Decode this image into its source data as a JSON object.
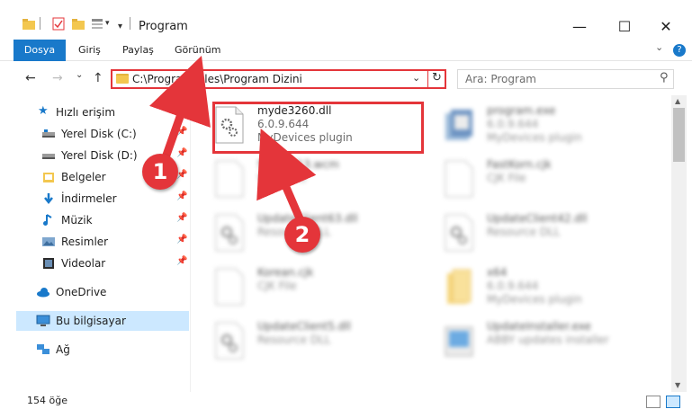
{
  "window": {
    "title": "Program",
    "controls": {
      "minimize": "—",
      "maximize": "☐",
      "close": "✕"
    }
  },
  "ribbon": {
    "tabs": [
      "Dosya",
      "Giriş",
      "Paylaş",
      "Görünüm"
    ],
    "expand_chevron": "⌄",
    "help": "?"
  },
  "navigation": {
    "back": "←",
    "forward": "→",
    "recent": "⌄",
    "up": "↑",
    "address_path": "C:\\Program Files\\Program Dizini",
    "address_dropdown": "⌄",
    "refresh": "↻",
    "search_placeholder": "Ara: Program",
    "search_glyph": "⚲"
  },
  "sidebar": {
    "quick_access": "Hızlı erişim",
    "items": [
      {
        "label": "Yerel Disk (C:)",
        "icon": "drive-icon",
        "pinned": true
      },
      {
        "label": "Yerel Disk (D:)",
        "icon": "drive-icon",
        "pinned": true
      },
      {
        "label": "Belgeler",
        "icon": "documents-icon",
        "pinned": true
      },
      {
        "label": "İndirmeler",
        "icon": "downloads-icon",
        "pinned": true
      },
      {
        "label": "Müzik",
        "icon": "music-icon",
        "pinned": true
      },
      {
        "label": "Resimler",
        "icon": "pictures-icon",
        "pinned": true
      },
      {
        "label": "Videolar",
        "icon": "videos-icon",
        "pinned": true
      }
    ],
    "onedrive": "OneDrive",
    "this_pc": "Bu bilgisayar",
    "network": "Ağ"
  },
  "files": [
    {
      "name": "myde3260.dll",
      "line2": "6.0.9.644",
      "line3": "MyDevices plugin",
      "icon": "dll-gear-icon",
      "highlighted": true
    },
    {
      "name": "program.exe",
      "line2": "6.0.9.644",
      "line3": "MyDevices plugin",
      "icon": "exe-app-icon"
    },
    {
      "name": "SSDWP13.wcm",
      "line2": "WCM File",
      "line3": "",
      "icon": "blank-file-icon"
    },
    {
      "name": "FastKorn.cjk",
      "line2": "CJK File",
      "line3": "",
      "icon": "blank-file-icon"
    },
    {
      "name": "UpdateClient63.dll",
      "line2": "Resource DLL",
      "line3": "",
      "icon": "dll-gear-icon"
    },
    {
      "name": "UpdateClient42.dll",
      "line2": "Resource DLL",
      "line3": "",
      "icon": "dll-gear-icon"
    },
    {
      "name": "Korean.cjk",
      "line2": "CJK File",
      "line3": "",
      "icon": "blank-file-icon"
    },
    {
      "name": "x64",
      "line2": "6.0.9.644",
      "line3": "MyDevices plugin",
      "icon": "folder-icon"
    },
    {
      "name": "UpdateClient5.dll",
      "line2": "Resource DLL",
      "line3": "",
      "icon": "dll-gear-icon"
    },
    {
      "name": "UpdateInstaller.exe",
      "line2": "ABBY updates installer",
      "line3": "",
      "icon": "installer-icon"
    }
  ],
  "callouts": [
    "1",
    "2"
  ],
  "status": {
    "item_count": "154 öğe"
  },
  "colors": {
    "accent": "#1979ca",
    "annotation": "#e4353a",
    "selection": "#cce8ff",
    "folder": "#f3c74f"
  }
}
